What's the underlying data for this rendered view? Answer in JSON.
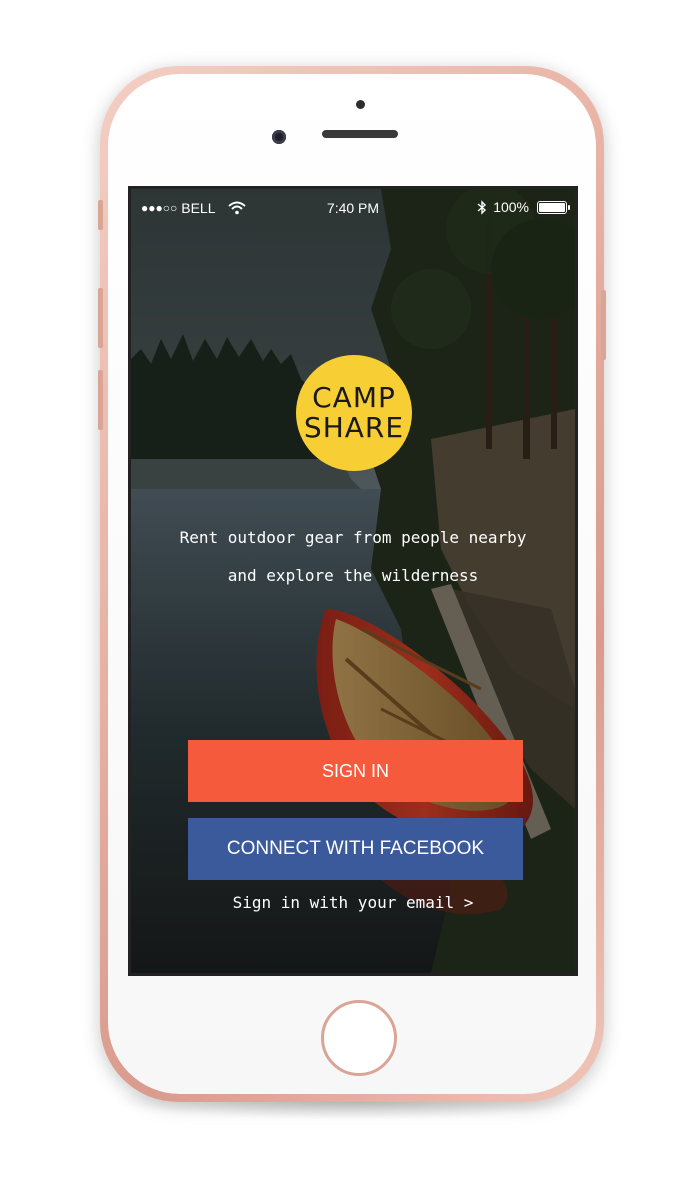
{
  "status_bar": {
    "signal_dots": "●●●○○",
    "carrier": "BELL",
    "time": "7:40 PM",
    "battery": "100%"
  },
  "logo": {
    "line1": "CAMP",
    "line2": "SHARE",
    "color": "#f7cf35"
  },
  "tagline": {
    "line1": "Rent outdoor gear from people nearby",
    "line2": "and explore the wilderness"
  },
  "buttons": {
    "sign_in": "SIGN IN",
    "facebook": "CONNECT WITH FACEBOOK",
    "email": "Sign in with your email >"
  },
  "colors": {
    "sign_in": "#f65a3c",
    "facebook": "#3b5a9b"
  }
}
